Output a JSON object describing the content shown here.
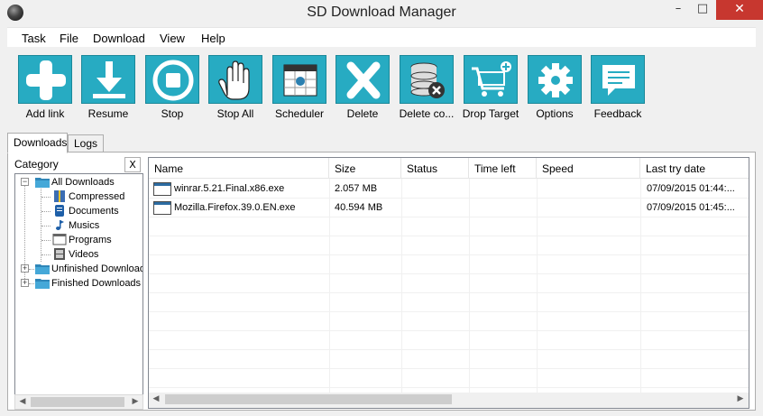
{
  "window": {
    "title": "SD Download Manager",
    "min_glyph": "–",
    "max_glyph": "□",
    "close_glyph": "✕"
  },
  "menu": [
    "Task",
    "File",
    "Download",
    "View",
    "Help"
  ],
  "toolbar": [
    {
      "label": "Add link",
      "icon": "plus-icon"
    },
    {
      "label": "Resume",
      "icon": "download-arrow-icon"
    },
    {
      "label": "Stop",
      "icon": "stop-icon"
    },
    {
      "label": "Stop All",
      "icon": "hand-icon"
    },
    {
      "label": "Scheduler",
      "icon": "calendar-icon"
    },
    {
      "label": "Delete",
      "icon": "x-icon"
    },
    {
      "label": "Delete co...",
      "icon": "database-delete-icon"
    },
    {
      "label": "Drop Target",
      "icon": "cart-icon"
    },
    {
      "label": "Options",
      "icon": "gear-icon"
    },
    {
      "label": "Feedback",
      "icon": "speech-bubble-icon"
    }
  ],
  "tabs": [
    {
      "label": "Downloads",
      "active": true
    },
    {
      "label": "Logs",
      "active": false
    }
  ],
  "category": {
    "header": "Category",
    "close_label": "X",
    "tree": [
      {
        "label": "All Downloads",
        "toggle": "−",
        "icon": "folder-icon"
      },
      {
        "label": "Compressed",
        "icon": "archive-icon"
      },
      {
        "label": "Documents",
        "icon": "document-icon"
      },
      {
        "label": "Musics",
        "icon": "music-note-icon"
      },
      {
        "label": "Programs",
        "icon": "program-icon"
      },
      {
        "label": "Videos",
        "icon": "film-icon"
      },
      {
        "label": "Unfinished Downloads",
        "toggle": "+",
        "icon": "folder-icon"
      },
      {
        "label": "Finished Downloads",
        "toggle": "+",
        "icon": "folder-icon"
      }
    ]
  },
  "downloads": {
    "columns": [
      "Name",
      "Size",
      "Status",
      "Time left",
      "Speed",
      "Last try date"
    ],
    "rows": [
      {
        "name": "winrar.5.21.Final.x86.exe",
        "size": "2.057 MB",
        "status": "",
        "time_left": "",
        "speed": "",
        "last_try": "07/09/2015 01:44:..."
      },
      {
        "name": "Mozilla.Firefox.39.0.EN.exe",
        "size": "40.594 MB",
        "status": "",
        "time_left": "",
        "speed": "",
        "last_try": "07/09/2015 01:45:..."
      }
    ]
  },
  "colors": {
    "toolbar_icon_bg": "#27abc2",
    "close_button": "#c7372f"
  },
  "scroll_glyphs": {
    "left": "◀",
    "right": "▶"
  }
}
